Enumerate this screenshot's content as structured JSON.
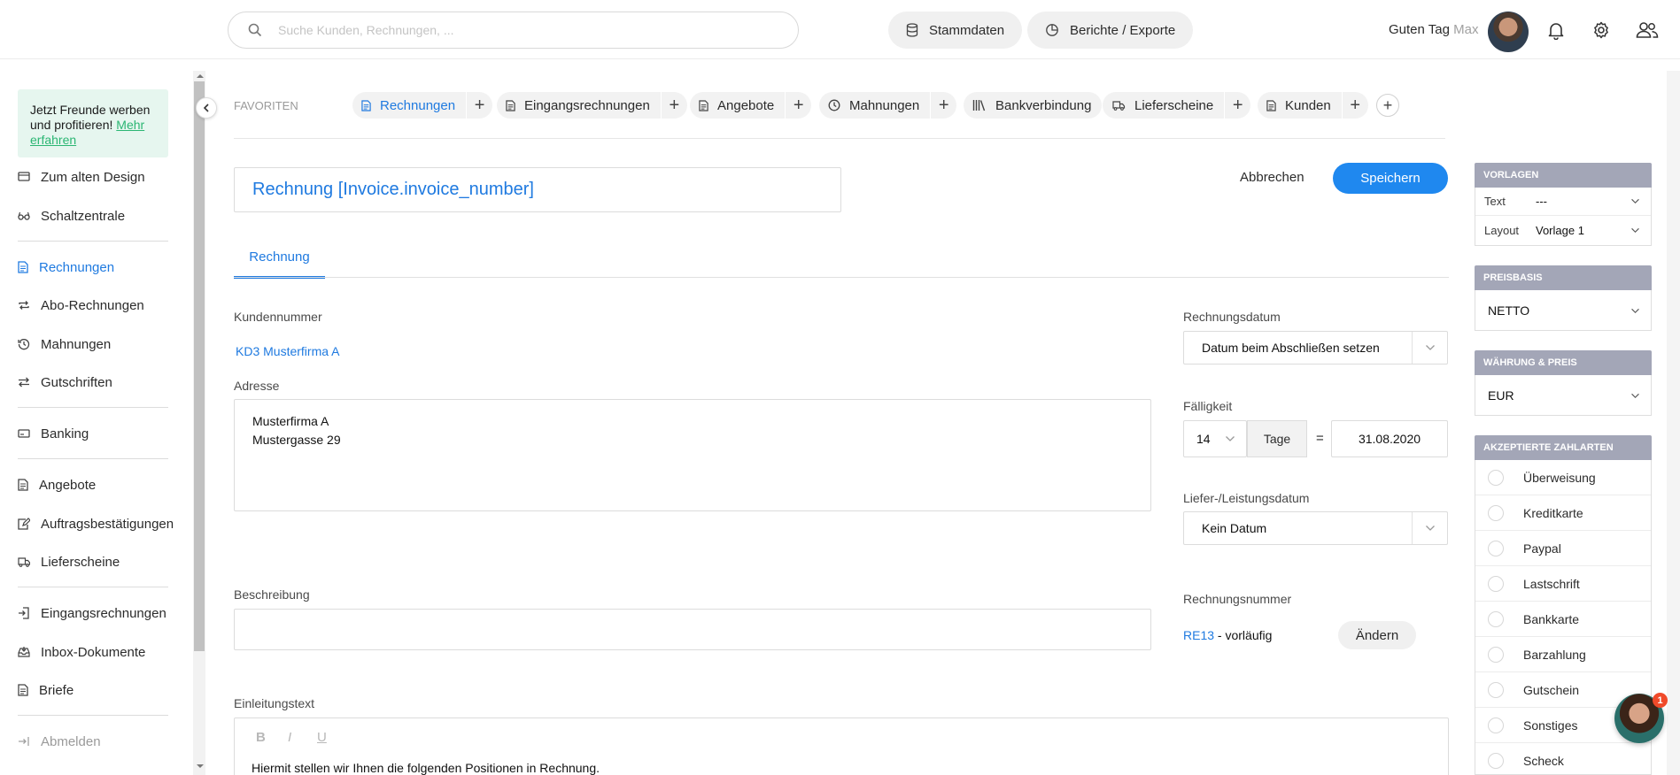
{
  "header": {
    "search_placeholder": "Suche Kunden, Rechnungen, ...",
    "stammdaten": "Stammdaten",
    "berichte": "Berichte / Exporte",
    "greeting": "Guten Tag",
    "user_name": "Max"
  },
  "sidebar": {
    "promo_text": "Jetzt Freunde werben und profitieren!",
    "promo_link": "Mehr erfahren",
    "items": [
      {
        "label": "Zum alten Design",
        "icon": "monitor-icon"
      },
      {
        "label": "Schaltzentrale",
        "icon": "glasses-icon"
      },
      {
        "label": "Rechnungen",
        "icon": "document-icon",
        "active": true
      },
      {
        "label": "Abo-Rechnungen",
        "icon": "repeat-icon"
      },
      {
        "label": "Mahnungen",
        "icon": "history-icon"
      },
      {
        "label": "Gutschriften",
        "icon": "exchange-icon"
      },
      {
        "label": "Banking",
        "icon": "bank-card-icon"
      },
      {
        "label": "Angebote",
        "icon": "document-icon"
      },
      {
        "label": "Auftragsbestätigungen",
        "icon": "edit-document-icon"
      },
      {
        "label": "Lieferscheine",
        "icon": "truck-icon"
      },
      {
        "label": "Eingangsrechnungen",
        "icon": "login-icon"
      },
      {
        "label": "Inbox-Dokumente",
        "icon": "inbox-icon"
      },
      {
        "label": "Briefe",
        "icon": "document-icon"
      },
      {
        "label": "Abmelden",
        "icon": "logout-icon"
      }
    ]
  },
  "favorites": {
    "label": "FAVORITEN",
    "items": [
      {
        "label": "Rechnungen",
        "icon": "document-icon",
        "active": true
      },
      {
        "label": "Eingangsrechnungen",
        "icon": "document-icon"
      },
      {
        "label": "Angebote",
        "icon": "document-icon"
      },
      {
        "label": "Mahnungen",
        "icon": "clock-icon"
      },
      {
        "label": "Bankverbindung",
        "icon": "library-icon"
      },
      {
        "label": "Lieferscheine",
        "icon": "truck-icon"
      },
      {
        "label": "Kunden",
        "icon": "document-icon"
      }
    ],
    "plus": "+"
  },
  "form": {
    "title": "Rechnung [Invoice.invoice_number]",
    "cancel": "Abbrechen",
    "save": "Speichern",
    "tab": "Rechnung",
    "customer_label": "Kundennummer",
    "customer_value": "KD3 Musterfirma A",
    "address_label": "Adresse",
    "address_line1": "Musterfirma A",
    "address_line2": "Mustergasse 29",
    "invoice_date_label": "Rechnungsdatum",
    "invoice_date_value": "Datum beim Abschließen setzen",
    "due_label": "Fälligkeit",
    "due_days": "14",
    "due_unit": "Tage",
    "equals": "=",
    "due_date": "31.08.2020",
    "delivery_label": "Liefer-/Leistungsdatum",
    "delivery_value": "Kein Datum",
    "description_label": "Beschreibung",
    "invoice_number_label": "Rechnungsnummer",
    "invoice_number": "RE13",
    "invoice_number_suffix": "- vorläufig",
    "change": "Ändern",
    "intro_label": "Einleitungstext",
    "intro_text": "Hiermit stellen wir Ihnen die folgenden Positionen in Rechnung.",
    "format_bold": "B",
    "format_italic": "I",
    "format_underline": "U"
  },
  "panel": {
    "templates_title": "VORLAGEN",
    "text_key": "Text",
    "text_value": "---",
    "layout_key": "Layout",
    "layout_value": "Vorlage 1",
    "price_title": "PREISBASIS",
    "price_value": "NETTO",
    "currency_title": "WÄHRUNG & PREIS",
    "currency_value": "EUR",
    "payments_title": "AKZEPTIERTE ZAHLARTEN",
    "payments": [
      "Überweisung",
      "Kreditkarte",
      "Paypal",
      "Lastschrift",
      "Bankkarte",
      "Barzahlung",
      "Gutschein",
      "Sonstiges",
      "Scheck"
    ]
  },
  "chat": {
    "badge": "1"
  },
  "colors": {
    "accent": "#1f7ae0",
    "save": "#1f88ef",
    "panel_header": "#a3a6b7",
    "promo_bg": "#e6f6ef",
    "promo_link": "#2bb673"
  }
}
